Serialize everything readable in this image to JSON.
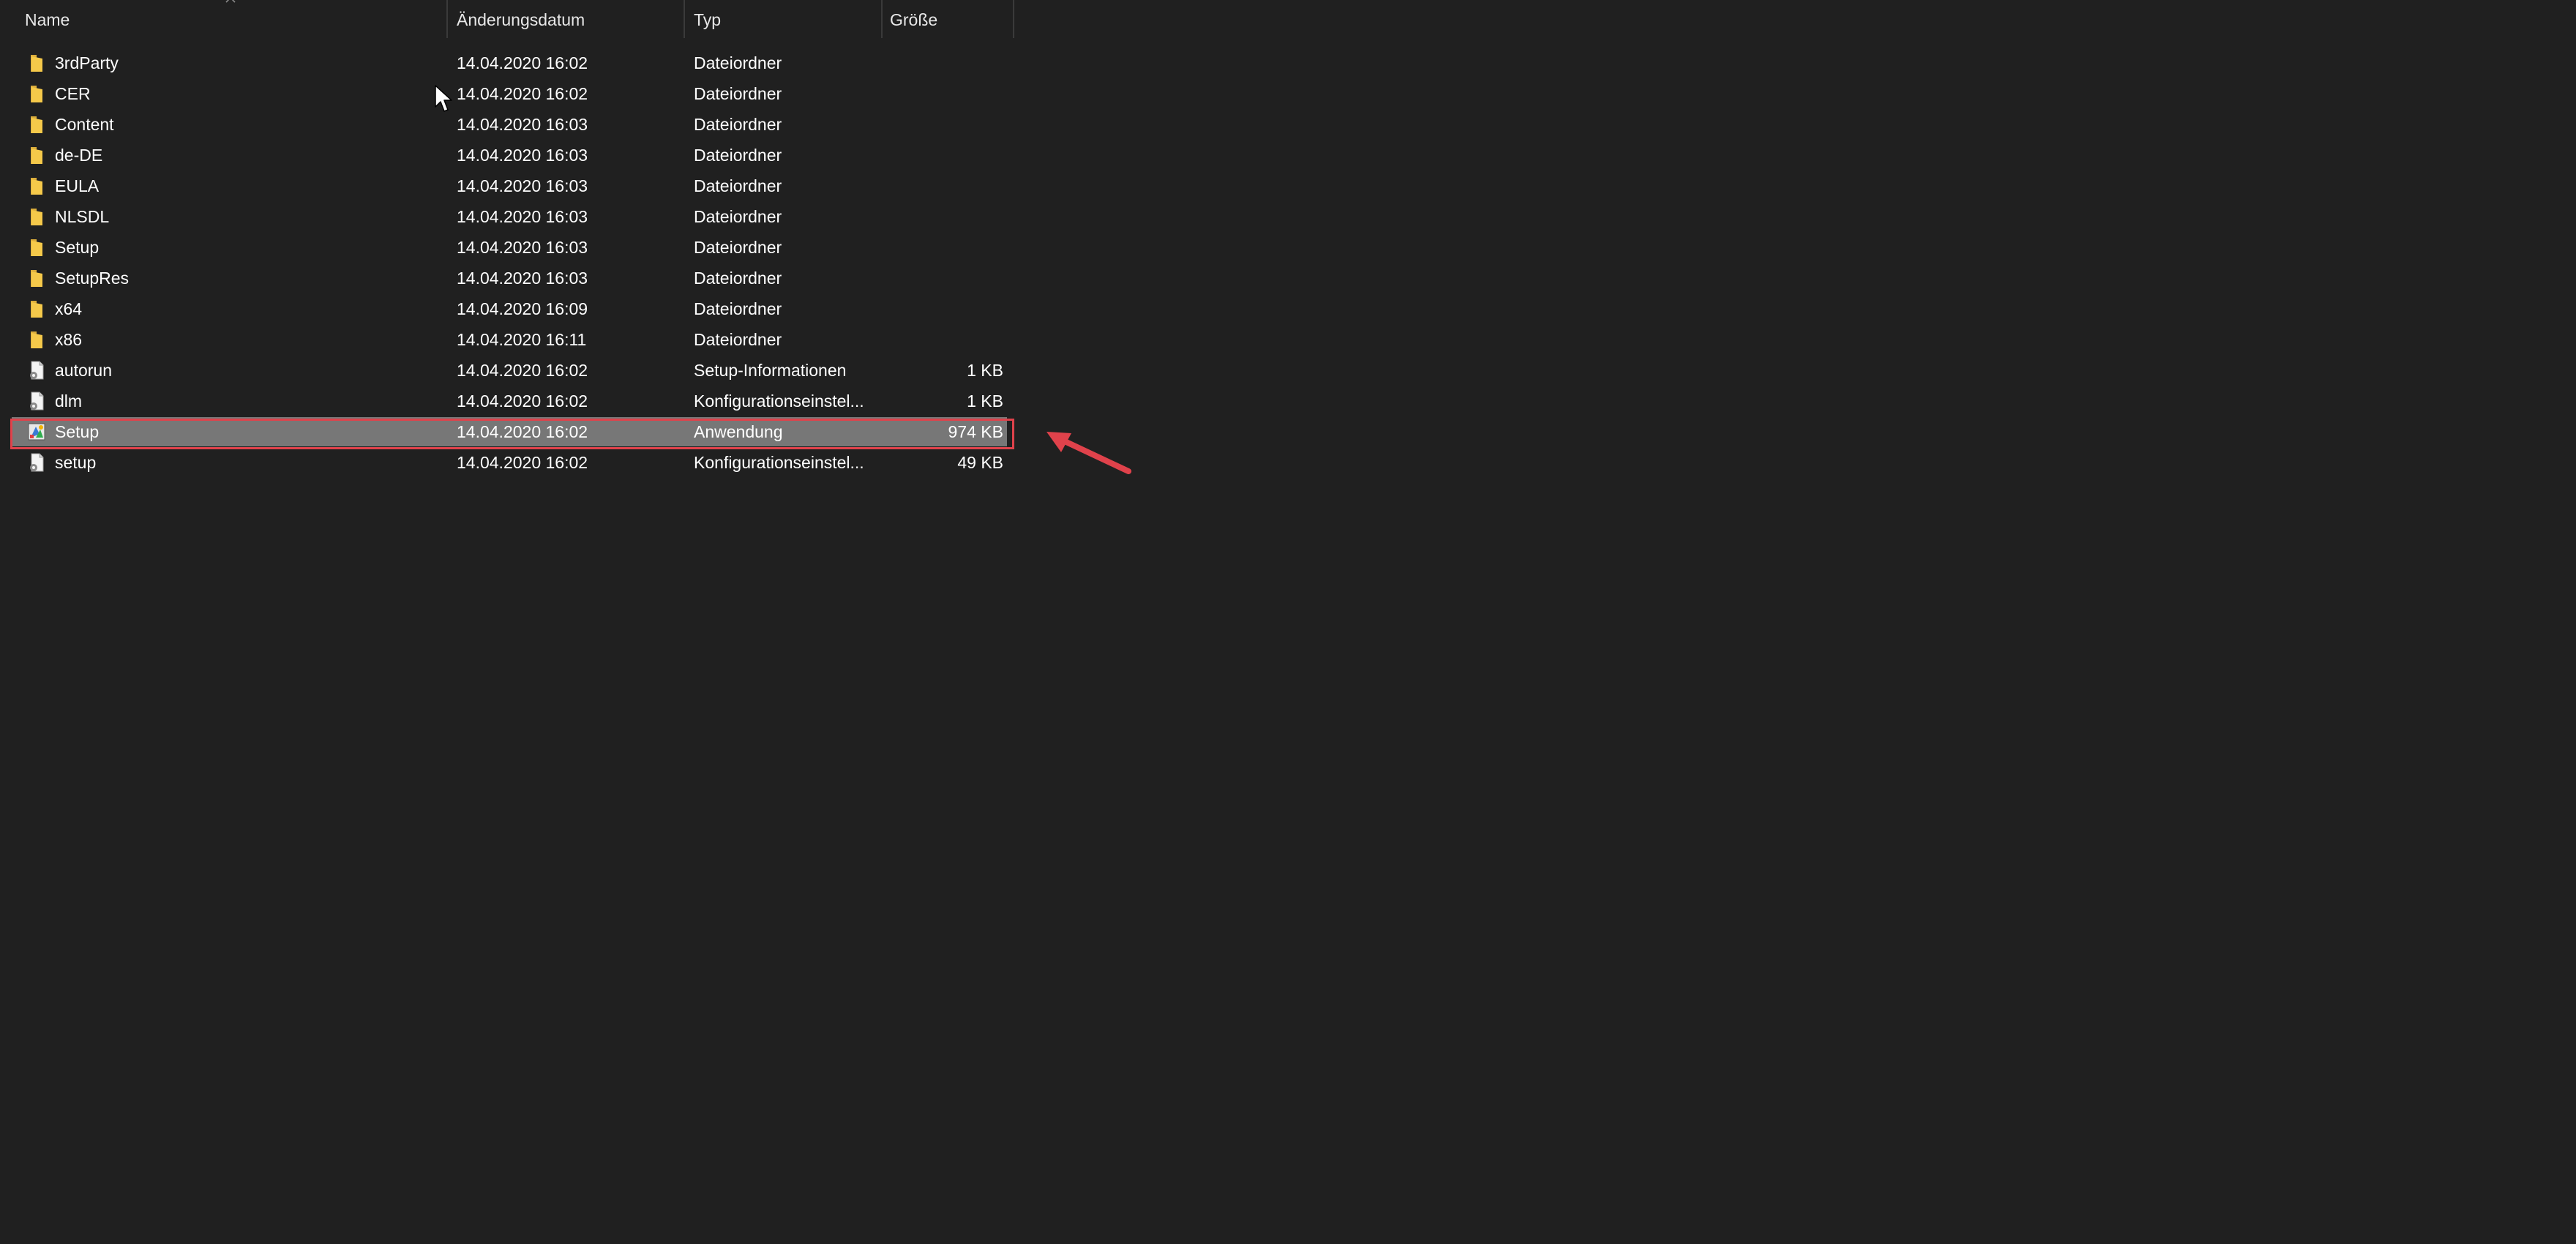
{
  "columns": {
    "name": "Name",
    "date": "Änderungsdatum",
    "type": "Typ",
    "size": "Größe"
  },
  "files": [
    {
      "name": "3rdParty",
      "date": "14.04.2020 16:02",
      "type": "Dateiordner",
      "size": "",
      "icon": "folder-icon"
    },
    {
      "name": "CER",
      "date": "14.04.2020 16:02",
      "type": "Dateiordner",
      "size": "",
      "icon": "folder-icon"
    },
    {
      "name": "Content",
      "date": "14.04.2020 16:03",
      "type": "Dateiordner",
      "size": "",
      "icon": "folder-icon"
    },
    {
      "name": "de-DE",
      "date": "14.04.2020 16:03",
      "type": "Dateiordner",
      "size": "",
      "icon": "folder-icon"
    },
    {
      "name": "EULA",
      "date": "14.04.2020 16:03",
      "type": "Dateiordner",
      "size": "",
      "icon": "folder-icon"
    },
    {
      "name": "NLSDL",
      "date": "14.04.2020 16:03",
      "type": "Dateiordner",
      "size": "",
      "icon": "folder-icon"
    },
    {
      "name": "Setup",
      "date": "14.04.2020 16:03",
      "type": "Dateiordner",
      "size": "",
      "icon": "folder-icon"
    },
    {
      "name": "SetupRes",
      "date": "14.04.2020 16:03",
      "type": "Dateiordner",
      "size": "",
      "icon": "folder-icon"
    },
    {
      "name": "x64",
      "date": "14.04.2020 16:09",
      "type": "Dateiordner",
      "size": "",
      "icon": "folder-icon"
    },
    {
      "name": "x86",
      "date": "14.04.2020 16:11",
      "type": "Dateiordner",
      "size": "",
      "icon": "folder-icon"
    },
    {
      "name": "autorun",
      "date": "14.04.2020 16:02",
      "type": "Setup-Informationen",
      "size": "1 KB",
      "icon": "settings-file-icon"
    },
    {
      "name": "dlm",
      "date": "14.04.2020 16:02",
      "type": "Konfigurationseinstel...",
      "size": "1 KB",
      "icon": "settings-file-icon"
    },
    {
      "name": "Setup",
      "date": "14.04.2020 16:02",
      "type": "Anwendung",
      "size": "974 KB",
      "icon": "setup-app-icon",
      "selected": true
    },
    {
      "name": "setup",
      "date": "14.04.2020 16:02",
      "type": "Konfigurationseinstel...",
      "size": "49 KB",
      "icon": "settings-file-icon"
    }
  ],
  "colors": {
    "background": "#202020",
    "selected_row": "#777777",
    "highlight_box": "#e0424b",
    "arrow": "#e0424b",
    "folder": "#f5c94a"
  }
}
